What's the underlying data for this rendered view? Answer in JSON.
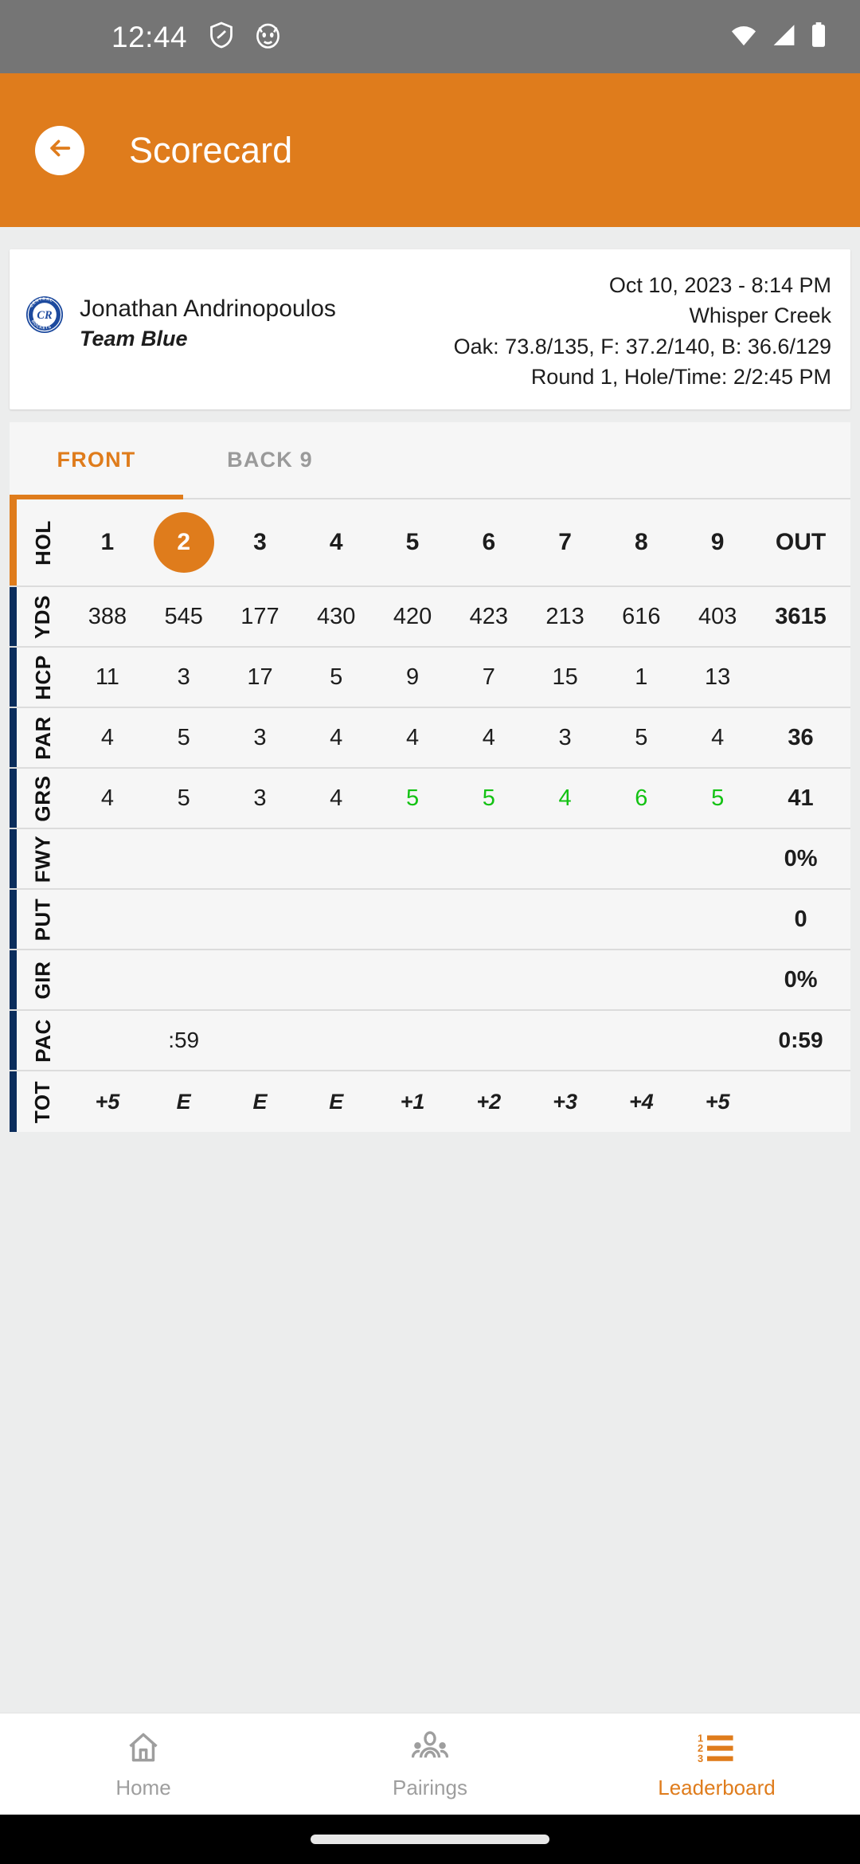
{
  "status_bar": {
    "time": "12:44",
    "icons": [
      "vpn-shield-icon",
      "cat-face-icon",
      "wifi-icon",
      "cell-signal-icon",
      "battery-icon"
    ]
  },
  "app_bar": {
    "title": "Scorecard",
    "back_icon": "arrow-left-icon",
    "background": "#df7c1c"
  },
  "info_card": {
    "logo_text_top": "CENTRAL",
    "logo_text_bottom": "ROCKETS",
    "logo_monogram": "CR",
    "player_name": "Jonathan Andrinopoulos",
    "team_name": "Team Blue",
    "datetime": "Oct 10, 2023 - 8:14 PM",
    "course": "Whisper Creek",
    "ratings": "Oak: 73.8/135, F: 37.2/140, B: 36.6/129",
    "round_info": "Round 1, Hole/Time: 2/2:45 PM"
  },
  "tabs": [
    {
      "label": "FRONT",
      "active": true
    },
    {
      "label": "BACK 9",
      "active": false
    }
  ],
  "colors": {
    "accent_orange": "#df7c1c",
    "accent_navy": "#0b2d5c",
    "birdie_green": "#13c213",
    "status_bar_gray": "#757575"
  },
  "scorecard": {
    "current_hole": "2",
    "rows": [
      {
        "label": "HOL",
        "accent": "#df7c1c",
        "values": [
          "1",
          "2",
          "3",
          "4",
          "5",
          "6",
          "7",
          "8",
          "9"
        ],
        "out": "OUT"
      },
      {
        "label": "YDS",
        "accent": "#0b2d5c",
        "values": [
          "388",
          "545",
          "177",
          "430",
          "420",
          "423",
          "213",
          "616",
          "403"
        ],
        "out": "3615"
      },
      {
        "label": "HCP",
        "accent": "#0b2d5c",
        "values": [
          "11",
          "3",
          "17",
          "5",
          "9",
          "7",
          "15",
          "1",
          "13"
        ],
        "out": ""
      },
      {
        "label": "PAR",
        "accent": "#0b2d5c",
        "values": [
          "4",
          "5",
          "3",
          "4",
          "4",
          "4",
          "3",
          "5",
          "4"
        ],
        "out": "36"
      },
      {
        "label": "GRS",
        "accent": "#0b2d5c",
        "values": [
          "4",
          "5",
          "3",
          "4",
          "5",
          "5",
          "4",
          "6",
          "5"
        ],
        "out": "41"
      },
      {
        "label": "FWY",
        "accent": "#0b2d5c",
        "values": [
          "",
          "",
          "",
          "",
          "",
          "",
          "",
          "",
          ""
        ],
        "out": "0%"
      },
      {
        "label": "PUT",
        "accent": "#0b2d5c",
        "values": [
          "",
          "",
          "",
          "",
          "",
          "",
          "",
          "",
          ""
        ],
        "out": "0"
      },
      {
        "label": "GIR",
        "accent": "#0b2d5c",
        "values": [
          "",
          "",
          "",
          "",
          "",
          "",
          "",
          "",
          ""
        ],
        "out": "0%"
      },
      {
        "label": "PAC",
        "accent": "#0b2d5c",
        "values": [
          "",
          ":59",
          "",
          "",
          "",
          "",
          "",
          "",
          ""
        ],
        "out": "0:59"
      },
      {
        "label": "TOT",
        "accent": "#0b2d5c",
        "values": [
          "+5",
          "E",
          "E",
          "E",
          "+1",
          "+2",
          "+3",
          "+4",
          "+5"
        ],
        "out": ""
      }
    ]
  },
  "bottom_nav": [
    {
      "label": "Home",
      "icon": "home-icon",
      "active": false
    },
    {
      "label": "Pairings",
      "icon": "people-icon",
      "active": false
    },
    {
      "label": "Leaderboard",
      "icon": "ranked-list-icon",
      "active": true
    }
  ]
}
